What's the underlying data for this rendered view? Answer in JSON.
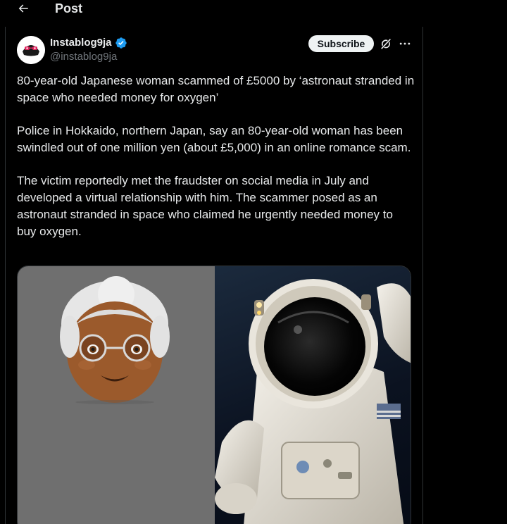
{
  "header": {
    "title": "Post"
  },
  "author": {
    "display_name": "Instablog9ja",
    "handle": "@instablog9ja",
    "avatar_text": "instablog9ja"
  },
  "actions": {
    "subscribe_label": "Subscribe"
  },
  "tweet": {
    "paragraphs": [
      "80-year-old Japanese woman scammed of £5000 by ‘astronaut stranded in space who needed money for oxygen’",
      "Police in Hokkaido, northern Japan, say an 80-year-old woman has been swindled out of one million yen (about £5,000) in an online romance scam.",
      "The victim reportedly met the fraudster on social media in July and developed a virtual relationship with him. The scammer posed as an astronaut stranded in space who claimed he urgently needed money to buy oxygen."
    ]
  },
  "colors": {
    "background": "#000000",
    "text": "#e7e9ea",
    "secondary_text": "#71767b",
    "verified": "#1d9bf0",
    "border": "#2f3336"
  },
  "icons": [
    "back-arrow-icon",
    "verified-badge-icon",
    "grok-icon",
    "more-icon"
  ]
}
